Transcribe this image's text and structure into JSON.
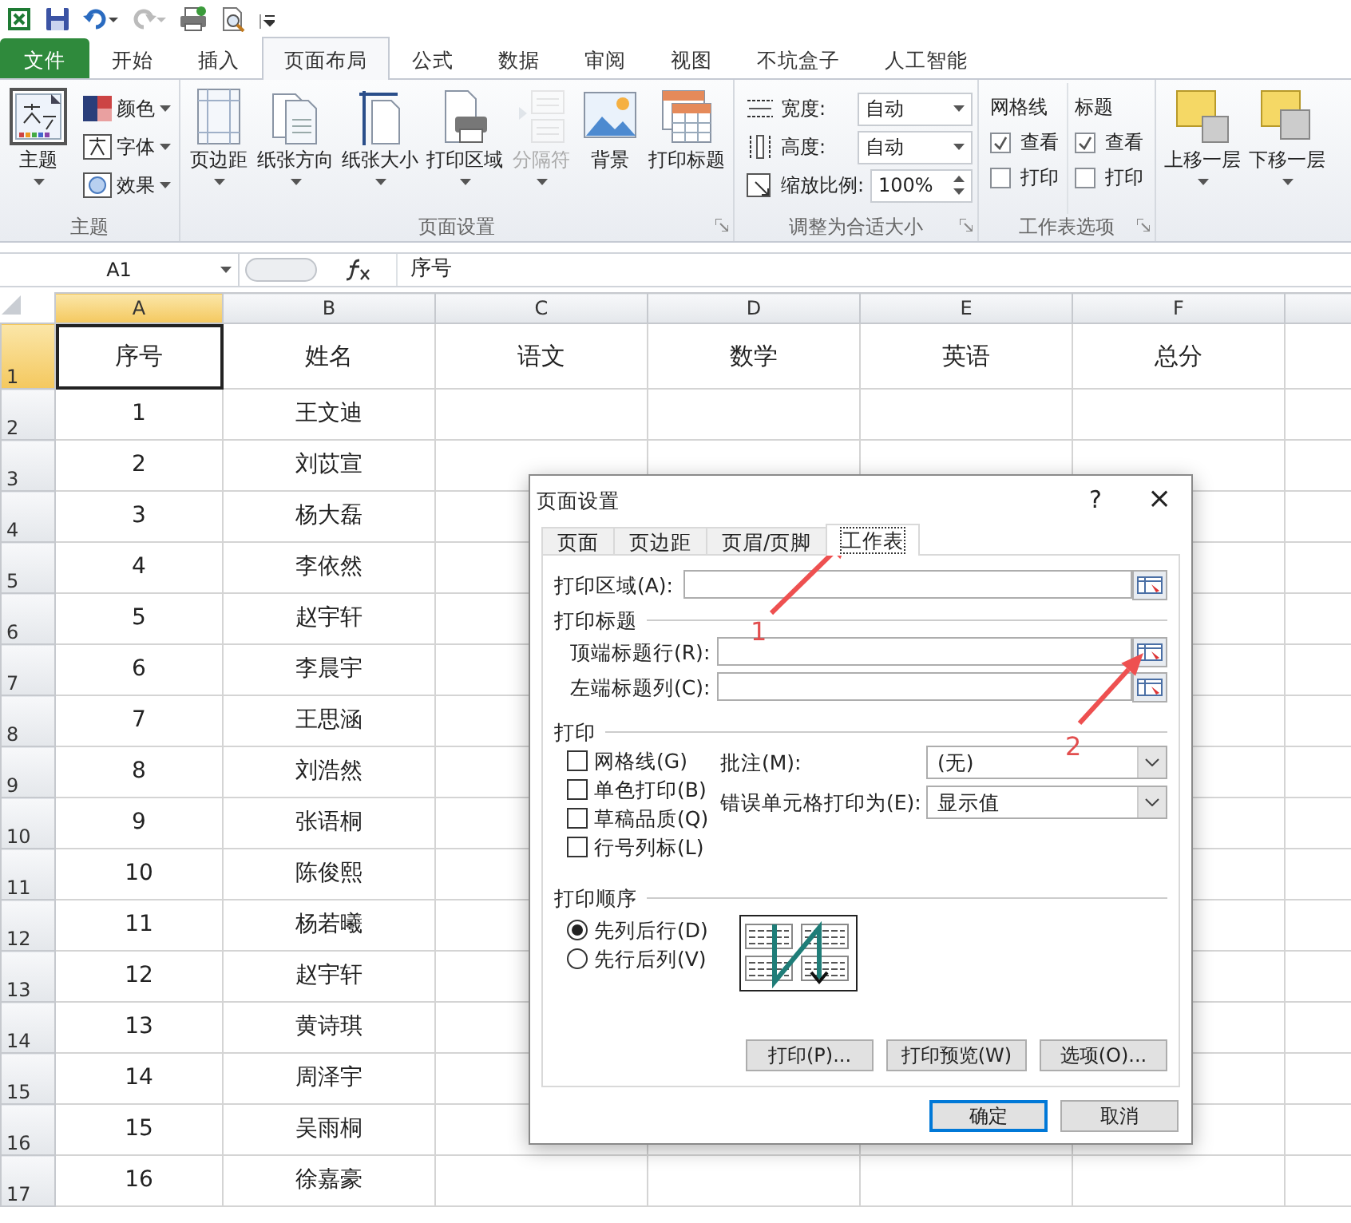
{
  "ribbon_tabs": [
    {
      "label": "文件",
      "kind": "file",
      "selected": false
    },
    {
      "label": "开始",
      "kind": "tab",
      "selected": false
    },
    {
      "label": "插入",
      "kind": "tab",
      "selected": false
    },
    {
      "label": "页面布局",
      "kind": "tab",
      "selected": true
    },
    {
      "label": "公式",
      "kind": "tab",
      "selected": false
    },
    {
      "label": "数据",
      "kind": "tab",
      "selected": false
    },
    {
      "label": "审阅",
      "kind": "tab",
      "selected": false
    },
    {
      "label": "视图",
      "kind": "tab",
      "selected": false
    },
    {
      "label": "不坑盒子",
      "kind": "tab",
      "selected": false
    },
    {
      "label": "人工智能",
      "kind": "tab",
      "selected": false
    }
  ],
  "ribbon_groups": [
    {
      "kind": "buttons",
      "label": "主题",
      "launcher": false,
      "items": [
        {
          "kind": "large",
          "label": "主题",
          "dropdown": true,
          "disabled": false
        },
        {
          "kind": "small",
          "label": "颜色",
          "dropdown": true,
          "disabled": false
        },
        {
          "kind": "small",
          "label": "字体",
          "dropdown": true,
          "disabled": false
        },
        {
          "kind": "small",
          "label": "效果",
          "dropdown": true,
          "disabled": false
        }
      ]
    },
    {
      "kind": "buttons",
      "label": "页面设置",
      "launcher": true,
      "items": [
        {
          "kind": "large",
          "label": "页边距",
          "dropdown": true,
          "disabled": false
        },
        {
          "kind": "large",
          "label": "纸张方向",
          "dropdown": true,
          "disabled": false
        },
        {
          "kind": "large",
          "label": "纸张大小",
          "dropdown": true,
          "disabled": false
        },
        {
          "kind": "large",
          "label": "打印区域",
          "dropdown": true,
          "disabled": false
        },
        {
          "kind": "large",
          "label": "分隔符",
          "dropdown": true,
          "disabled": true
        },
        {
          "kind": "large",
          "label": "背景",
          "dropdown": false,
          "disabled": false
        },
        {
          "kind": "large",
          "label": "打印标题",
          "dropdown": false,
          "disabled": false
        }
      ]
    },
    {
      "kind": "fields",
      "label": "调整为合适大小",
      "launcher": true,
      "items": [
        {
          "kind": "dropdown",
          "label": "宽度:",
          "value": "自动"
        },
        {
          "kind": "dropdown",
          "label": "高度:",
          "value": "自动"
        },
        {
          "kind": "spinner",
          "label": "缩放比例:",
          "value": "100%"
        }
      ]
    },
    {
      "kind": "options",
      "label": "工作表选项",
      "launcher": true,
      "columns": [
        {
          "title": "网格线",
          "options": [
            {
              "label": "查看",
              "checked": true
            },
            {
              "label": "打印",
              "checked": false
            }
          ]
        },
        {
          "title": "标题",
          "options": [
            {
              "label": "查看",
              "checked": true
            },
            {
              "label": "打印",
              "checked": false
            }
          ]
        }
      ]
    },
    {
      "kind": "buttons",
      "items": [
        {
          "kind": "large",
          "label": "上移一层",
          "dropdown": true,
          "disabled": false
        },
        {
          "kind": "large",
          "label": "下移一层",
          "dropdown": true,
          "disabled": false
        }
      ]
    }
  ],
  "formula_bar": {
    "name_box": "A1",
    "formula": "序号"
  },
  "sheet": {
    "columns": [
      {
        "label": "A",
        "selected": true
      },
      {
        "label": "B",
        "selected": false
      },
      {
        "label": "C",
        "selected": false
      },
      {
        "label": "D",
        "selected": false
      },
      {
        "label": "E",
        "selected": false
      },
      {
        "label": "F",
        "selected": false
      }
    ],
    "rows": [
      {
        "header": "1",
        "selected": true,
        "cells": [
          "序号",
          "姓名",
          "语文",
          "数学",
          "英语",
          "总分"
        ]
      },
      {
        "header": "2",
        "selected": false,
        "cells": [
          "1",
          "王文迪"
        ]
      },
      {
        "header": "3",
        "selected": false,
        "cells": [
          "2",
          "刘苡宣"
        ]
      },
      {
        "header": "4",
        "selected": false,
        "cells": [
          "3",
          "杨大磊"
        ]
      },
      {
        "header": "5",
        "selected": false,
        "cells": [
          "4",
          "李依然"
        ]
      },
      {
        "header": "6",
        "selected": false,
        "cells": [
          "5",
          "赵宇轩"
        ]
      },
      {
        "header": "7",
        "selected": false,
        "cells": [
          "6",
          "李晨宇"
        ]
      },
      {
        "header": "8",
        "selected": false,
        "cells": [
          "7",
          "王思涵"
        ]
      },
      {
        "header": "9",
        "selected": false,
        "cells": [
          "8",
          "刘浩然"
        ]
      },
      {
        "header": "10",
        "selected": false,
        "cells": [
          "9",
          "张语桐"
        ]
      },
      {
        "header": "11",
        "selected": false,
        "cells": [
          "10",
          "陈俊熙"
        ]
      },
      {
        "header": "12",
        "selected": false,
        "cells": [
          "11",
          "杨若曦"
        ]
      },
      {
        "header": "13",
        "selected": false,
        "cells": [
          "12",
          "赵宇轩"
        ]
      },
      {
        "header": "14",
        "selected": false,
        "cells": [
          "13",
          "黄诗琪"
        ]
      },
      {
        "header": "15",
        "selected": false,
        "cells": [
          "14",
          "周泽宇"
        ]
      },
      {
        "header": "16",
        "selected": false,
        "cells": [
          "15",
          "吴雨桐"
        ]
      },
      {
        "header": "17",
        "selected": false,
        "cells": [
          "16",
          "徐嘉豪"
        ]
      }
    ]
  },
  "dialog": {
    "title": "页面设置",
    "help": "?",
    "close": "×",
    "tabs": [
      {
        "label": "页面",
        "selected": false
      },
      {
        "label": "页边距",
        "selected": false
      },
      {
        "label": "页眉/页脚",
        "selected": false
      },
      {
        "label": "工作表",
        "selected": true
      }
    ],
    "print_area": {
      "label": "打印区域(A):"
    },
    "titles_section": "打印标题",
    "title_fields": [
      {
        "label": "顶端标题行(R):"
      },
      {
        "label": "左端标题列(C):"
      }
    ],
    "print_section": "打印",
    "print_checks": [
      {
        "label": "网格线(G)",
        "checked": false
      },
      {
        "label": "单色打印(B)",
        "checked": false
      },
      {
        "label": "草稿品质(Q)",
        "checked": false
      },
      {
        "label": "行号列标(L)",
        "checked": false
      }
    ],
    "print_selects": [
      {
        "label": "批注(M):",
        "value": "(无)"
      },
      {
        "label": "错误单元格打印为(E):",
        "value": "显示值"
      }
    ],
    "order_section": "打印顺序",
    "order_options": [
      {
        "label": "先列后行(D)",
        "selected": true
      },
      {
        "label": "先行后列(V)",
        "selected": false
      }
    ],
    "panel_buttons": [
      "打印(P)...",
      "打印预览(W)",
      "选项(O)..."
    ],
    "buttons": [
      {
        "label": "确定",
        "default": true
      },
      {
        "label": "取消",
        "default": false
      }
    ]
  },
  "annotations": [
    {
      "label": "1"
    },
    {
      "label": "2"
    }
  ]
}
